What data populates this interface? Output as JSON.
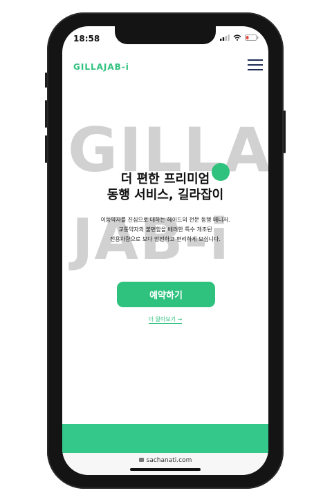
{
  "status_bar": {
    "time": "18:58"
  },
  "header": {
    "logo": "GILLAJAB-i",
    "menu_icon": "hamburger-icon"
  },
  "hero": {
    "bg_word_top": "GILLA",
    "bg_word_bottom": "JAB-i",
    "headline_line1": "더 편한 프리미엄",
    "headline_line2": "동행 서비스, 길라잡이",
    "desc_line1": "이동약자를 진심으로 대하는 헤이드의 전문 동행 매니저.",
    "desc_line2": "교통약자의 불편함을 배려한 특수 개조된",
    "desc_line3": "전용차량으로 보다 안전하고 편리하게 모십니다.",
    "cta_label": "예약하기",
    "more_label": "더 알아보기 →"
  },
  "browser": {
    "url": "sachanati.com"
  },
  "colors": {
    "accent": "#2ec27e",
    "menu": "#1d2b53",
    "watermark": "#c9c9c9"
  }
}
